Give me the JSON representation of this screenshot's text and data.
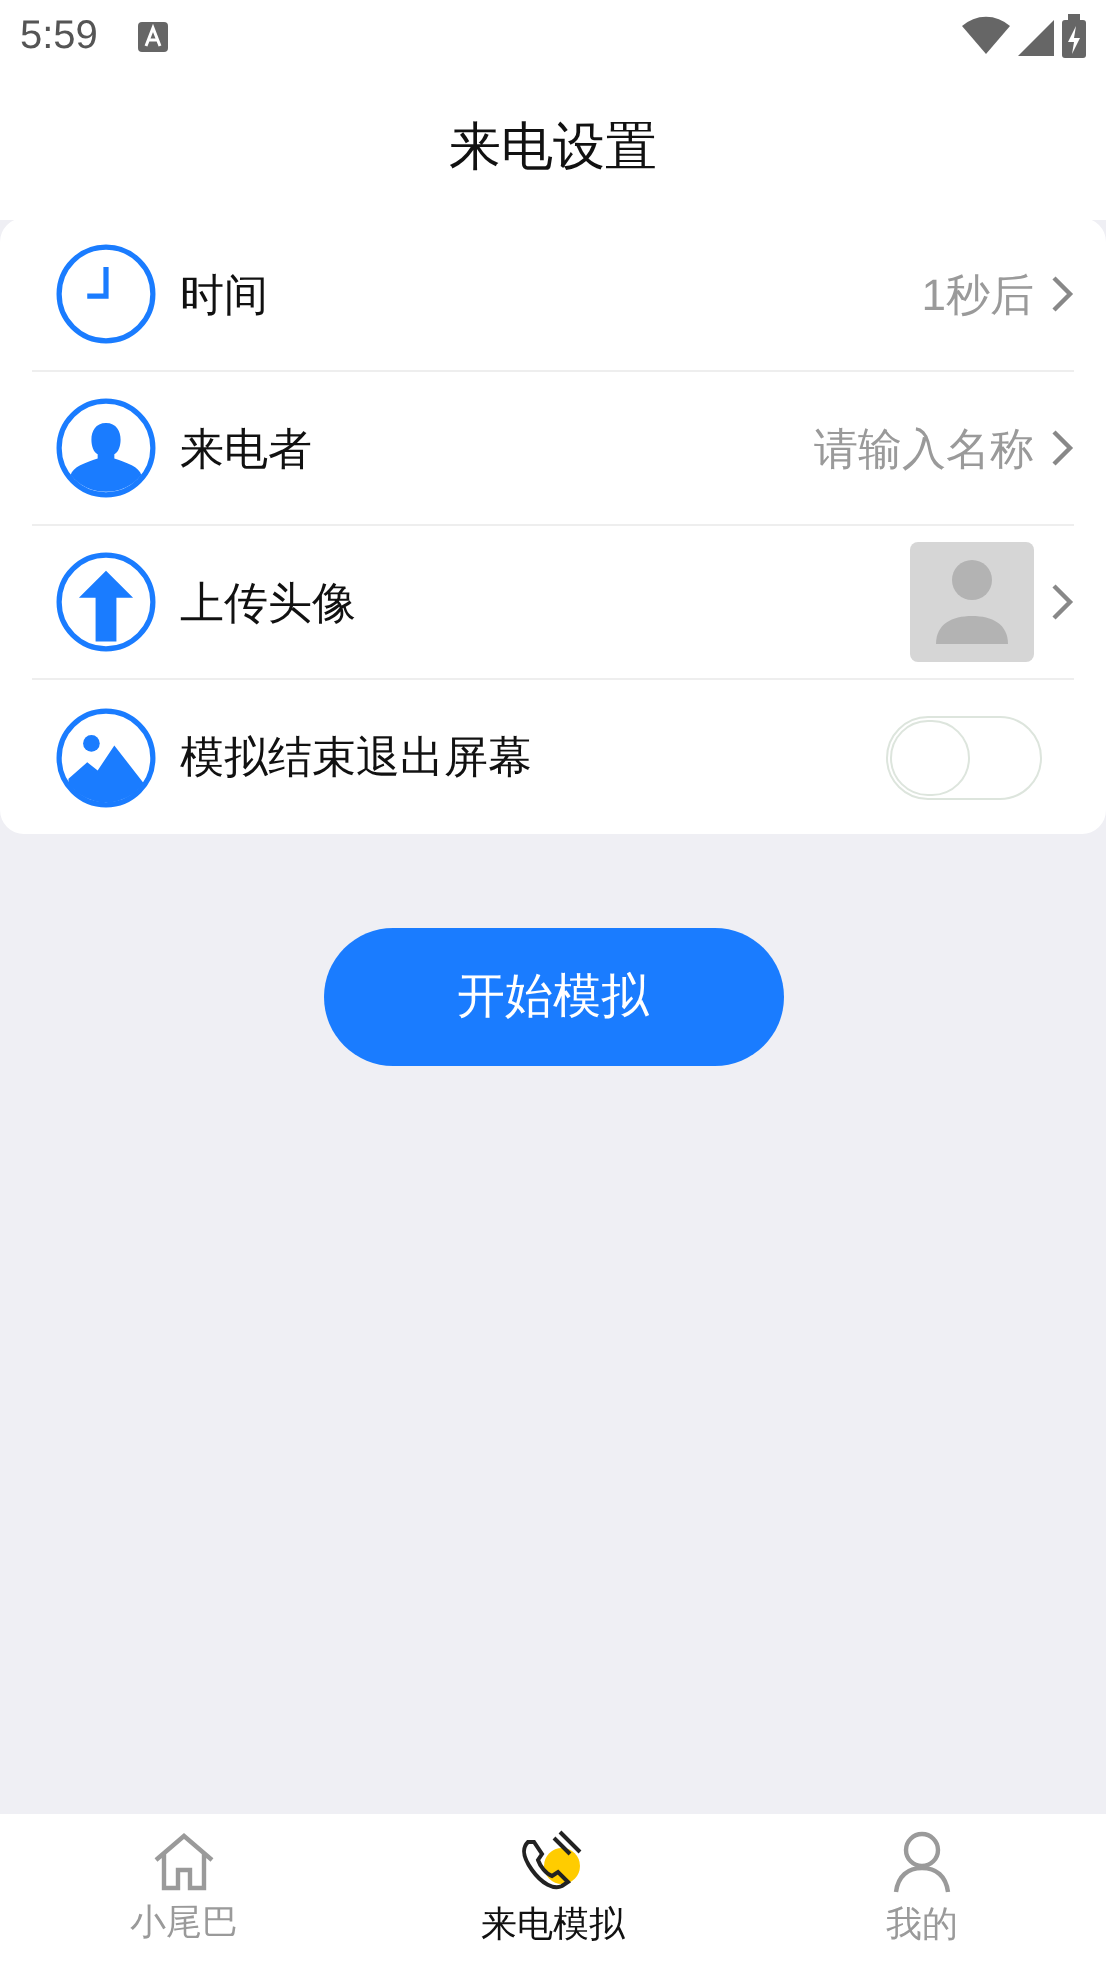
{
  "status_bar": {
    "time": "5:59"
  },
  "header": {
    "title": "来电设置"
  },
  "settings": [
    {
      "kind": "value",
      "label": "时间",
      "value": "1秒后"
    },
    {
      "kind": "value",
      "label": "来电者",
      "value": "请输入名称"
    },
    {
      "kind": "avatar",
      "label": "上传头像"
    },
    {
      "kind": "toggle",
      "label": "模拟结束退出屏幕",
      "on": false
    }
  ],
  "start_button": {
    "label": "开始模拟"
  },
  "bottom_nav": [
    {
      "label": "小尾巴",
      "selected": false
    },
    {
      "label": "来电模拟",
      "selected": true
    },
    {
      "label": "我的",
      "selected": false
    }
  ]
}
